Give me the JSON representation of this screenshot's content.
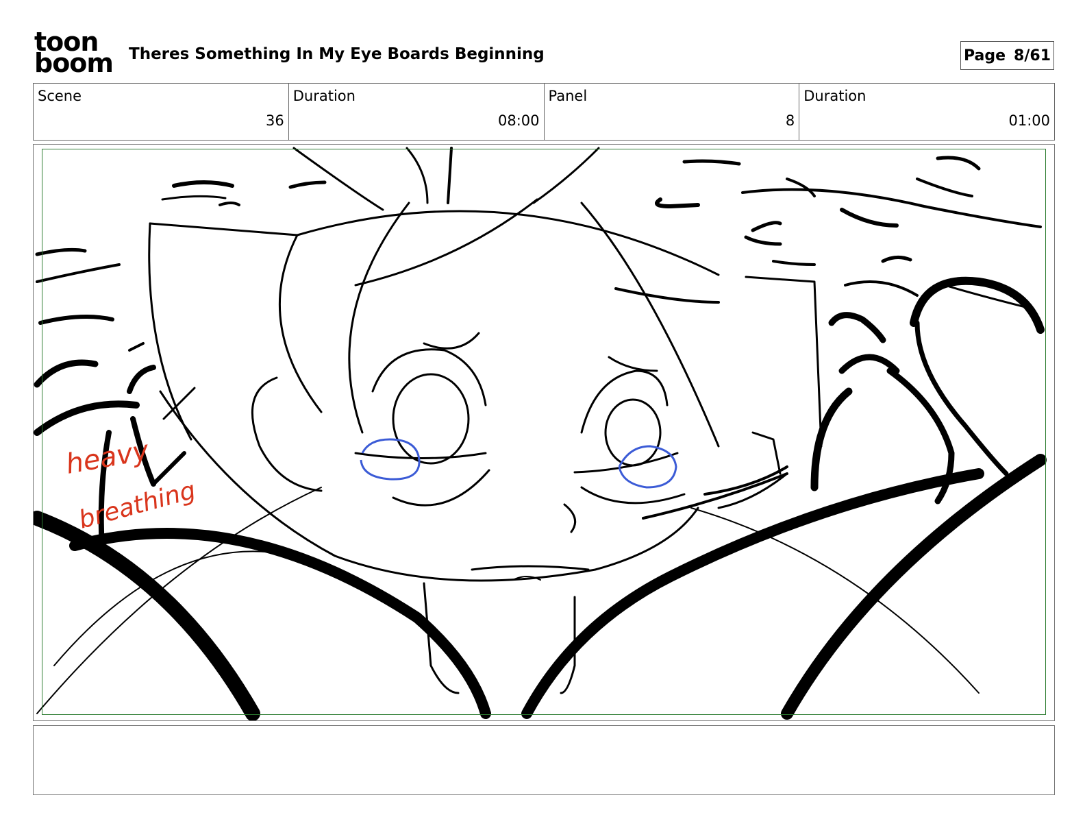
{
  "header": {
    "logo_line1": "toon",
    "logo_line2": "boom",
    "title": "Theres Something In My Eye Boards Beginning",
    "page_label": "Page",
    "page_value": "8/61"
  },
  "info": {
    "scene_label": "Scene",
    "scene_value": "36",
    "scene_duration_label": "Duration",
    "scene_duration_value": "08:00",
    "panel_label": "Panel",
    "panel_value": "8",
    "panel_duration_label": "Duration",
    "panel_duration_value": "01:00"
  },
  "panel_image": {
    "annotation_line1": "heavy",
    "annotation_line2": "breathing",
    "colors": {
      "ink": "#000000",
      "annotation": "#d9351c",
      "eye_highlight": "#3b5bd6",
      "safe_frame": "#2e7d32"
    }
  },
  "notes": {
    "text": ""
  }
}
